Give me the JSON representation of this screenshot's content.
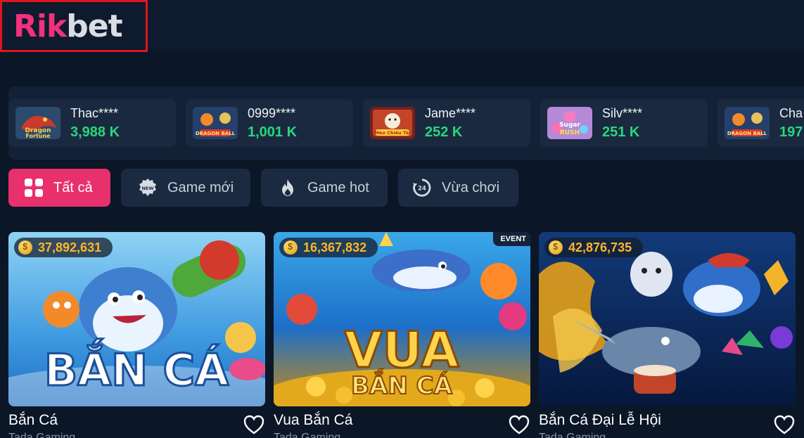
{
  "brand": {
    "logo_r": "R",
    "logo_ik": "ik",
    "logo_bet": "bet"
  },
  "winners": [
    {
      "name": "Thac****",
      "amount": "3,988 K",
      "game_icon": "dragon-fortune-icon",
      "thumb_text": "Dragon Fortune"
    },
    {
      "name": "0999****",
      "amount": "1,001 K",
      "game_icon": "dragon-ball-icon",
      "thumb_text": ""
    },
    {
      "name": "Jame****",
      "amount": "252 K",
      "game_icon": "meo-chieu-tai-icon",
      "thumb_text": ""
    },
    {
      "name": "Silv****",
      "amount": "251 K",
      "game_icon": "sugar-rush-icon",
      "thumb_text": "Sugar Rush"
    },
    {
      "name": "Cha",
      "amount": "197",
      "game_icon": "dragon-ball-icon",
      "thumb_text": ""
    }
  ],
  "tabs": [
    {
      "label": "Tất cả",
      "icon": "grid-icon",
      "active": true
    },
    {
      "label": "Game mới",
      "icon": "new-badge-icon",
      "active": false
    },
    {
      "label": "Game hot",
      "icon": "fire-icon",
      "active": false
    },
    {
      "label": "Vừa chơi",
      "icon": "history-24-icon",
      "active": false
    }
  ],
  "games": [
    {
      "title": "Bắn Cá",
      "jackpot": "37,892,631",
      "banner_text": "BẮN CÁ",
      "event": "",
      "subtitle": "Tada Gaming"
    },
    {
      "title": "Vua Bắn Cá",
      "jackpot": "16,367,832",
      "banner_text": "VUA",
      "banner_text2": "BẮN CÁ",
      "event": "EVENT",
      "subtitle": "Tada Gaming"
    },
    {
      "title": "Bắn Cá Đại Lễ Hội",
      "jackpot": "42,876,735",
      "banner_text": "",
      "event": "",
      "subtitle": "Tada Gaming"
    }
  ],
  "colors": {
    "accent": "#e8306c",
    "win_green": "#27d87a",
    "jackpot_gold": "#ffb629",
    "bg": "#0b1627"
  }
}
